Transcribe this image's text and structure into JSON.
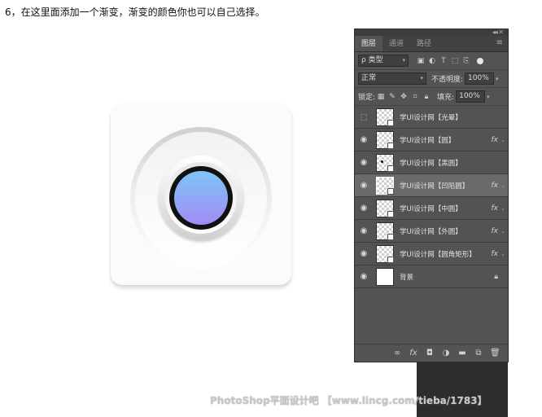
{
  "instruction": "6，在这里面添加一个渐变，渐变的颜色你也可以自己选择。",
  "artwork": {
    "gradient_top": "#7fc4f8",
    "gradient_bottom": "#a18cf5"
  },
  "panel": {
    "tabs": [
      {
        "label": "图层",
        "active": true
      },
      {
        "label": "通道",
        "active": false
      },
      {
        "label": "路径",
        "active": false
      }
    ],
    "filter": {
      "label": "ρ 类型"
    },
    "blend_mode": "正常",
    "opacity_label": "不透明度:",
    "opacity_value": "100%",
    "lock_label": "锁定:",
    "fill_label": "填充:",
    "fill_value": "100%",
    "layers": [
      {
        "name": "学UI设计网【光晕】",
        "visible": false,
        "fx": false,
        "selected": false
      },
      {
        "name": "学UI设计网【圆】",
        "visible": true,
        "fx": true,
        "selected": false
      },
      {
        "name": "学UI设计网【黑圆】",
        "visible": true,
        "fx": false,
        "selected": false
      },
      {
        "name": "学UI设计网【凹陷圆】",
        "visible": true,
        "fx": true,
        "selected": true
      },
      {
        "name": "学UI设计网【中圆】",
        "visible": true,
        "fx": true,
        "selected": false
      },
      {
        "name": "学UI设计网【外圆】",
        "visible": true,
        "fx": true,
        "selected": false
      },
      {
        "name": "学UI设计网【圆角矩形】",
        "visible": true,
        "fx": true,
        "selected": false
      },
      {
        "name": "背景",
        "visible": true,
        "fx": false,
        "selected": false,
        "locked": true
      }
    ],
    "fx_label": "fx"
  },
  "watermark": "PhotoShop平面设计吧 【www.lincg.com/tieba/1783】"
}
